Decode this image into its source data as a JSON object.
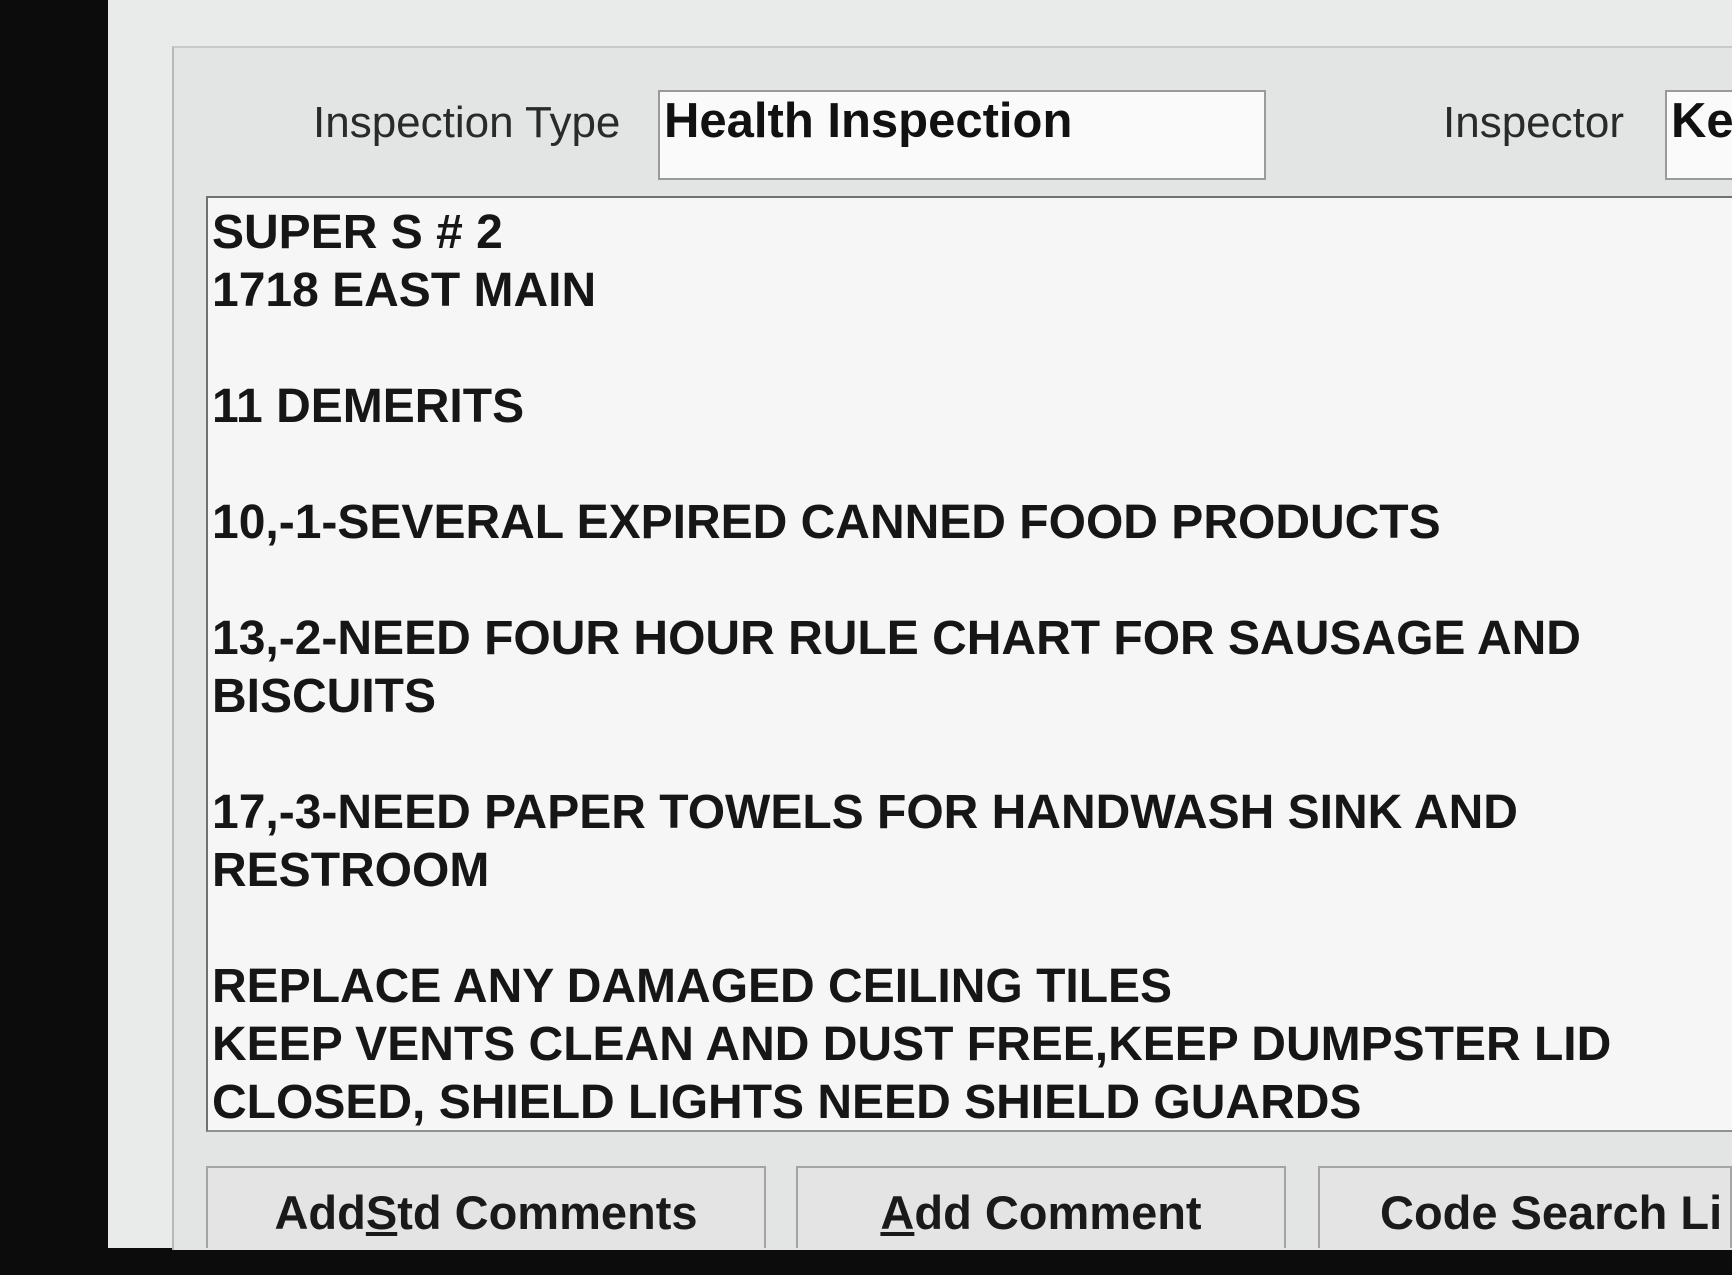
{
  "form": {
    "inspection_type_label": "Inspection Type",
    "inspection_type_value": "Health Inspection",
    "inspector_label": "Inspector",
    "inspector_value": "Ke"
  },
  "comments": {
    "lines": [
      "SUPER S # 2",
      "1718 EAST MAIN",
      "",
      "11 DEMERITS",
      "",
      "10,-1-SEVERAL EXPIRED CANNED FOOD PRODUCTS",
      "",
      "13,-2-NEED FOUR HOUR RULE CHART FOR SAUSAGE AND",
      "BISCUITS",
      "",
      "17,-3-NEED PAPER TOWELS FOR HANDWASH SINK AND",
      "RESTROOM",
      "",
      "REPLACE ANY DAMAGED CEILING TILES",
      "KEEP VENTS CLEAN AND DUST FREE,KEEP DUMPSTER LID",
      "CLOSED, SHIELD LIGHTS NEED SHIELD GUARDS"
    ]
  },
  "buttons": {
    "add_std_comments": {
      "pre": "Add ",
      "mnemonic": "S",
      "post": "td Comments"
    },
    "add_comment": {
      "pre": "",
      "mnemonic": "A",
      "post": "dd Comment"
    },
    "code_search": {
      "label": "Code Search Li"
    }
  }
}
